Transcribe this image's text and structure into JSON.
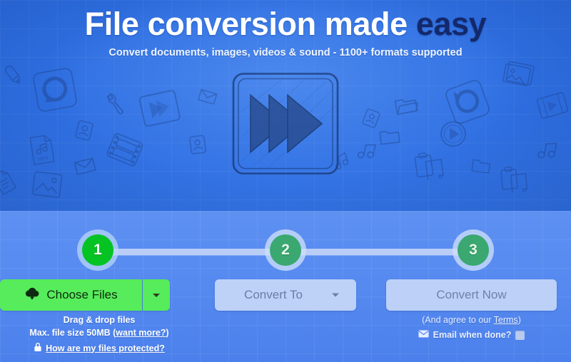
{
  "hero": {
    "headline_main": "File conversion made ",
    "headline_accent": "easy",
    "subhead": "Convert documents, images, videos & sound - 1100+ formats supported",
    "center_illustration": "fast-forward-play-sketch-icon",
    "background_icons": [
      "pencil-icon",
      "refresh-icon",
      "wrench-icon",
      "play-box-icon",
      "mail-icon",
      "contact-card-icon",
      "mp3-file-icon",
      "film-strip-icon",
      "photo-icon",
      "folder-open-icon",
      "folder-icon",
      "music-note-icon",
      "play-circle-icon",
      "clipboard-icon",
      "image-stack-icon",
      "video-strip-icon",
      "document-icon"
    ]
  },
  "stepper": {
    "steps": [
      {
        "number": "1",
        "state": "active"
      },
      {
        "number": "2",
        "state": "idle"
      },
      {
        "number": "3",
        "state": "idle"
      }
    ]
  },
  "actions": {
    "choose_files_label": "Choose Files",
    "choose_files_icon": "cloud-upload-icon",
    "choose_files_caret": "chevron-down-icon",
    "convert_to_label": "Convert To",
    "convert_to_caret": "chevron-down-icon",
    "convert_now_label": "Convert Now"
  },
  "help_left": {
    "drag_drop": "Drag & drop files",
    "max_size_prefix": "Max. file size 50MB (",
    "max_size_link": "want more?",
    "max_size_suffix": ")",
    "protected_link": "How are my files protected?",
    "lock_icon": "lock-icon"
  },
  "help_right": {
    "terms_prefix": "(And agree to our ",
    "terms_link": "Terms",
    "terms_suffix": ")",
    "email_label": "Email when done?",
    "email_icon": "envelope-icon",
    "email_checked": false
  },
  "colors": {
    "hero_blue": "#2f6fe2",
    "panel_blue": "#5589ef",
    "accent_navy": "#14296b",
    "green_active": "#04c323",
    "green_idle": "#3aa870",
    "button_green": "#56ec5b",
    "button_disabled": "#bed1f7",
    "track": "#b9cdf7"
  }
}
